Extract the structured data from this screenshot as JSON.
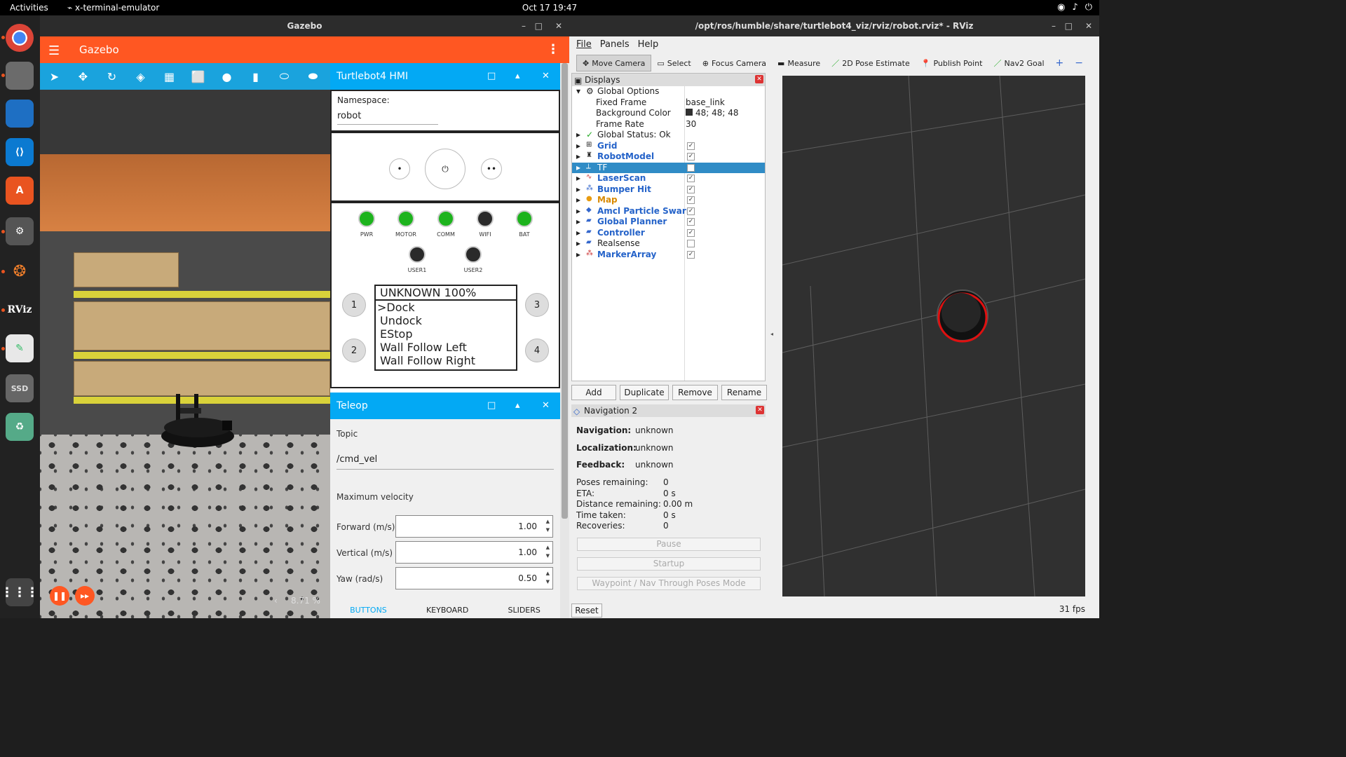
{
  "topbar": {
    "activities": "Activities",
    "app": "x-terminal-emulator",
    "clock": "Oct 17  19:47"
  },
  "dock": {
    "icons": [
      "chrome-icon",
      "files-icon",
      "libreoffice-icon",
      "vscode-icon",
      "app-center-icon",
      "settings-icon",
      "gazebo-icon",
      "rviz-icon",
      "text-editor-icon",
      "ssd-icon",
      "trash-icon",
      "app-grid-icon"
    ],
    "rviz_label": "RViz",
    "ssd_label": "SSD"
  },
  "gazebo": {
    "window_title": "Gazebo",
    "app_name": "Gazebo",
    "rtf": "8.71 %",
    "hmi": {
      "title": "Turtlebot4 HMI",
      "namespace_label": "Namespace:",
      "namespace_value": "robot",
      "leds": [
        {
          "label": "PWR",
          "color": "#1db31d"
        },
        {
          "label": "MOTOR",
          "color": "#1db31d"
        },
        {
          "label": "COMM",
          "color": "#1db31d"
        },
        {
          "label": "WIFI",
          "color": "#2a2a2a"
        },
        {
          "label": "BAT",
          "color": "#1db31d"
        },
        {
          "label": "USER1",
          "color": "#2a2a2a"
        },
        {
          "label": "USER2",
          "color": "#2a2a2a"
        }
      ],
      "menu_header": "UNKNOWN 100%",
      "menu_items": [
        ">Dock",
        "Undock",
        "EStop",
        "Wall Follow Left",
        "Wall Follow Right"
      ],
      "buttons": [
        "1",
        "2",
        "3",
        "4"
      ]
    },
    "teleop": {
      "title": "Teleop",
      "topic_label": "Topic",
      "topic_value": "/cmd_vel",
      "maxvel_label": "Maximum velocity",
      "forward_label": "Forward (m/s)",
      "forward_value": "1.00",
      "vertical_label": "Vertical (m/s)",
      "vertical_value": "1.00",
      "yaw_label": "Yaw (rad/s)",
      "yaw_value": "0.50",
      "tabs": [
        "BUTTONS",
        "KEYBOARD",
        "SLIDERS"
      ]
    }
  },
  "rviz": {
    "window_title": "/opt/ros/humble/share/turtlebot4_viz/rviz/robot.rviz* - RViz",
    "menu": [
      "File",
      "Panels",
      "Help"
    ],
    "tools": [
      "Move Camera",
      "Select",
      "Focus Camera",
      "Measure",
      "2D Pose Estimate",
      "Publish Point",
      "Nav2 Goal"
    ],
    "displays_title": "Displays",
    "global_options": "Global Options",
    "fixed_frame_label": "Fixed Frame",
    "fixed_frame_value": "base_link",
    "bg_color_label": "Background Color",
    "bg_color_value": "48; 48; 48",
    "frame_rate_label": "Frame Rate",
    "frame_rate_value": "30",
    "global_status": "Global Status: Ok",
    "plugins": [
      {
        "name": "Grid",
        "checked": true
      },
      {
        "name": "RobotModel",
        "checked": true
      },
      {
        "name": "TF",
        "checked": false
      },
      {
        "name": "LaserScan",
        "checked": true
      },
      {
        "name": "Bumper Hit",
        "checked": true
      },
      {
        "name": "Map",
        "checked": true
      },
      {
        "name": "Amcl Particle Swarm",
        "checked": true
      },
      {
        "name": "Global Planner",
        "checked": true
      },
      {
        "name": "Controller",
        "checked": true
      },
      {
        "name": "Realsense",
        "checked": false
      },
      {
        "name": "MarkerArray",
        "checked": true
      }
    ],
    "buttons": [
      "Add",
      "Duplicate",
      "Remove",
      "Rename"
    ],
    "nav_title": "Navigation 2",
    "navigation_label": "Navigation:",
    "navigation_value": "unknown",
    "localization_label": "Localization:",
    "localization_value": "unknown",
    "feedback_label": "Feedback:",
    "feedback_value": "unknown",
    "poses_label": "Poses remaining:",
    "poses_value": "0",
    "eta_label": "ETA:",
    "eta_value": "0 s",
    "dist_label": "Distance remaining:",
    "dist_value": "0.00 m",
    "time_label": "Time taken:",
    "time_value": "0 s",
    "recov_label": "Recoveries:",
    "recov_value": "0",
    "pause": "Pause",
    "startup": "Startup",
    "waypoint": "Waypoint / Nav Through Poses Mode",
    "reset": "Reset",
    "fps": "31 fps"
  }
}
